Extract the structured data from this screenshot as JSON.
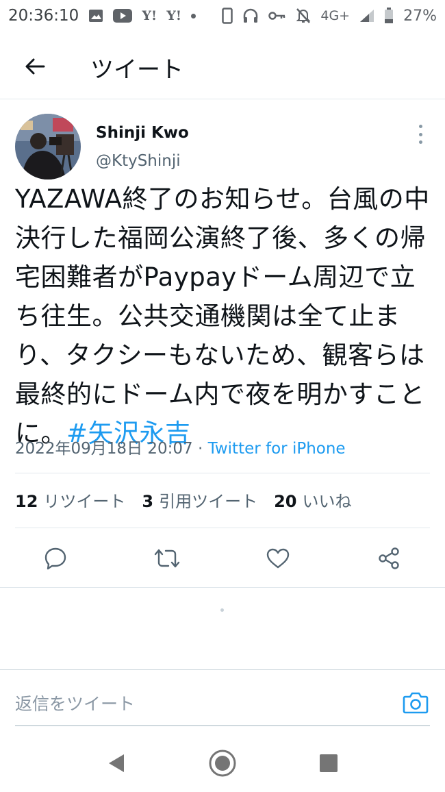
{
  "status_bar": {
    "time": "20:36:10",
    "network": "4G+",
    "battery": "27%",
    "left_icons": [
      "image-icon",
      "youtube-icon",
      "yahoo-icon",
      "yahoo-icon",
      "dot-icon"
    ],
    "right_icons": [
      "phone-icon",
      "headset-icon",
      "key-icon",
      "mute-icon",
      "signal-icon",
      "battery-icon"
    ],
    "yahoo_text": "Y!"
  },
  "app_bar": {
    "title": "ツイート",
    "back_icon": "back-arrow-icon"
  },
  "tweet": {
    "author_name": "Shinji Kwo",
    "author_handle": "@KtyShinji",
    "text": "YAZAWA終了のお知らせ。台風の中決行した福岡公演終了後、多くの帰宅困難者がPaypayドーム周辺で立ち往生。公共交通機関は全て止まり、タクシーもないため、観客らは最終的にドーム内で夜を明かすことに。",
    "hashtag": "#矢沢永吉",
    "timestamp": "2022年09月18日 20:07",
    "separator": "·",
    "source": "Twitter for iPhone"
  },
  "stats": {
    "retweets_count": "12",
    "retweets_label": "リツイート",
    "quotes_count": "3",
    "quotes_label": "引用ツイート",
    "likes_count": "20",
    "likes_label": "いいね"
  },
  "actions": [
    "reply-icon",
    "retweet-icon",
    "like-icon",
    "share-icon"
  ],
  "reply_box": {
    "placeholder": "返信をツイート",
    "camera_icon": "camera-icon"
  },
  "nav_bar": [
    "back-triangle-icon",
    "home-circle-icon",
    "recents-square-icon"
  ],
  "colors": {
    "accent": "#1d9bf0",
    "text": "#0f1419",
    "secondary": "#536471",
    "divider": "#e1e8ed"
  }
}
